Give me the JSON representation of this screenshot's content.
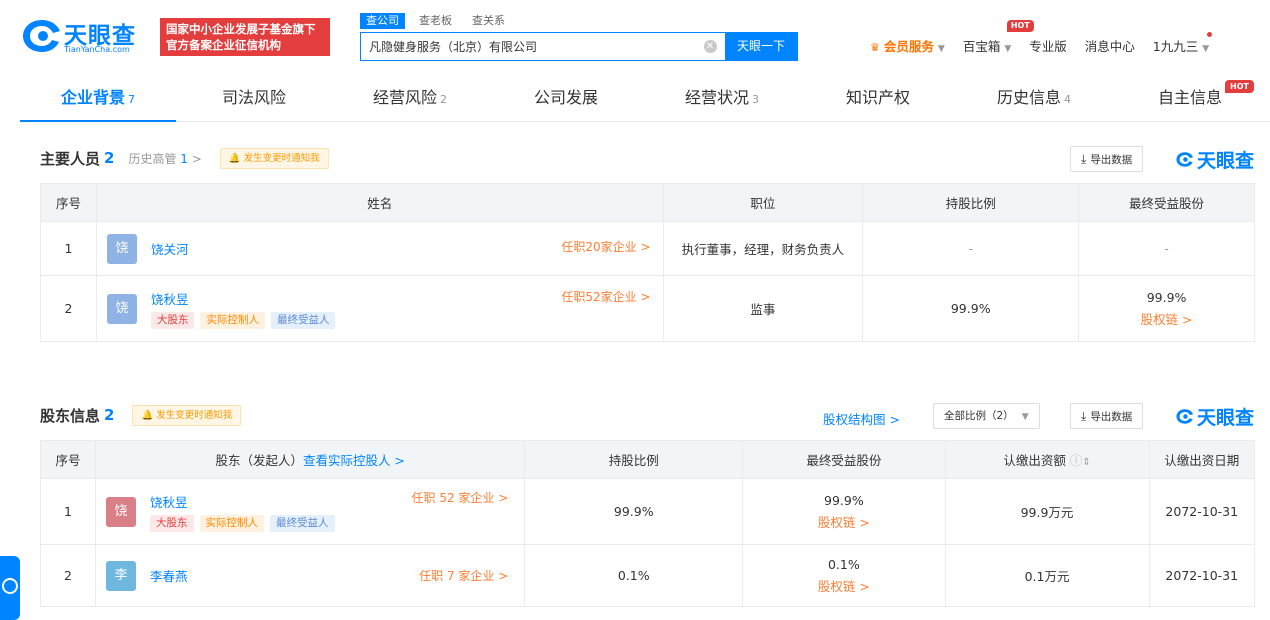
{
  "brand": {
    "name": "天眼查",
    "domain": "TianYanCha.com",
    "badge_line1": "国家中小企业发展子基金旗下",
    "badge_line2": "官方备案企业征信机构"
  },
  "search": {
    "tabs": [
      "查公司",
      "查老板",
      "查关系"
    ],
    "value": "凡隐健身服务（北京）有限公司",
    "button": "天眼一下"
  },
  "nav": {
    "vip": "会员服务",
    "treasure": "百宝箱",
    "hot": "HOT",
    "pro": "专业版",
    "messages": "消息中心",
    "user": "1九九三"
  },
  "tabs": [
    {
      "label": "企业背景",
      "count": "7"
    },
    {
      "label": "司法风险",
      "count": ""
    },
    {
      "label": "经营风险",
      "count": "2"
    },
    {
      "label": "公司发展",
      "count": ""
    },
    {
      "label": "经营状况",
      "count": "3"
    },
    {
      "label": "知识产权",
      "count": ""
    },
    {
      "label": "历史信息",
      "count": "4"
    },
    {
      "label": "自主信息",
      "count": ""
    }
  ],
  "tab_hot": "HOT",
  "personnel": {
    "title": "主要人员",
    "count": "2",
    "history_label": "历史高管",
    "history_count": "1",
    "history_arrow": ">",
    "notify": "发生变更时通知我",
    "export": "导出数据",
    "brand": "天眼查",
    "headers": [
      "序号",
      "姓名",
      "职位",
      "持股比例",
      "最终受益股份"
    ],
    "rows": [
      {
        "idx": "1",
        "avatar": "饶",
        "name": "饶关河",
        "tags": [],
        "roles": "任职20家企业 >",
        "position": "执行董事，经理，财务负责人",
        "share": "-",
        "benefit": "-",
        "chain": ""
      },
      {
        "idx": "2",
        "avatar": "饶",
        "name": "饶秋昱",
        "tags": [
          "大股东",
          "实际控制人",
          "最终受益人"
        ],
        "roles": "任职52家企业 >",
        "position": "监事",
        "share": "99.9%",
        "benefit": "99.9%",
        "chain": "股权链 >"
      }
    ]
  },
  "shareholders": {
    "title": "股东信息",
    "count": "2",
    "notify": "发生变更时通知我",
    "structure_link": "股权结构图 >",
    "ratio_select": "全部比例（2）",
    "export": "导出数据",
    "brand": "天眼查",
    "headers": {
      "idx": "序号",
      "holder": "股东（发起人）",
      "holder_link": "查看实际控股人 >",
      "share": "持股比例",
      "benefit": "最终受益股份",
      "capital": "认缴出资额",
      "date": "认缴出资日期"
    },
    "rows": [
      {
        "idx": "1",
        "avatar": "饶",
        "name": "饶秋昱",
        "tags": [
          "大股东",
          "实际控制人",
          "最终受益人"
        ],
        "roles": "任职 52 家企业 >",
        "share": "99.9%",
        "benefit": "99.9%",
        "chain": "股权链 >",
        "capital": "99.9万元",
        "date": "2072-10-31"
      },
      {
        "idx": "2",
        "avatar": "李",
        "name": "李春燕",
        "tags": [],
        "roles": "任职 7 家企业 >",
        "share": "0.1%",
        "benefit": "0.1%",
        "chain": "股权链 >",
        "capital": "0.1万元",
        "date": "2072-10-31"
      }
    ]
  },
  "colors": {
    "accent": "#0084ff",
    "orange": "#ff7e33",
    "red": "#e43d3d"
  }
}
